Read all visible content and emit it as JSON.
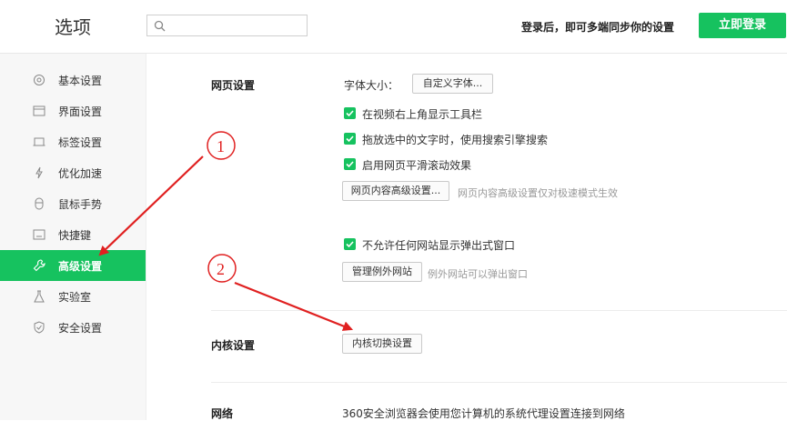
{
  "header": {
    "title": "选项",
    "search": {
      "value": "",
      "placeholder": ""
    },
    "login_hint": "登录后，即可多端同步你的设置",
    "login_button": "立即登录"
  },
  "sidebar": {
    "items": [
      {
        "label": "基本设置",
        "icon": "gear-icon"
      },
      {
        "label": "界面设置",
        "icon": "window-icon"
      },
      {
        "label": "标签设置",
        "icon": "tab-icon"
      },
      {
        "label": "优化加速",
        "icon": "lightning-icon"
      },
      {
        "label": "鼠标手势",
        "icon": "mouse-icon"
      },
      {
        "label": "快捷键",
        "icon": "keyboard-icon"
      },
      {
        "label": "高级设置",
        "icon": "wrench-icon",
        "active": true
      },
      {
        "label": "实验室",
        "icon": "flask-icon"
      },
      {
        "label": "安全设置",
        "icon": "shield-icon"
      }
    ]
  },
  "webpage": {
    "label": "网页设置",
    "font_size_label": "字体大小：",
    "custom_font_button": "自定义字体...",
    "checkboxes": [
      {
        "label": "在视频右上角显示工具栏",
        "checked": true
      },
      {
        "label": "拖放选中的文字时，使用搜索引擎搜索",
        "checked": true
      },
      {
        "label": "启用网页平滑滚动效果",
        "checked": true
      }
    ],
    "advanced_button": "网页内容高级设置...",
    "advanced_hint": "网页内容高级设置仅对极速模式生效",
    "popup_checkbox": {
      "label": "不允许任何网站显示弹出式窗口",
      "checked": true
    },
    "manage_exceptions_button": "管理例外网站",
    "exceptions_hint": "例外网站可以弹出窗口"
  },
  "kernel": {
    "label": "内核设置",
    "switch_button": "内核切换设置"
  },
  "network": {
    "label": "网络",
    "text": "360安全浏览器会使用您计算机的系统代理设置连接到网络"
  },
  "annotations": {
    "mark1": "1",
    "mark2": "2",
    "color": "#e02020"
  },
  "colors": {
    "accent": "#16c25f"
  }
}
